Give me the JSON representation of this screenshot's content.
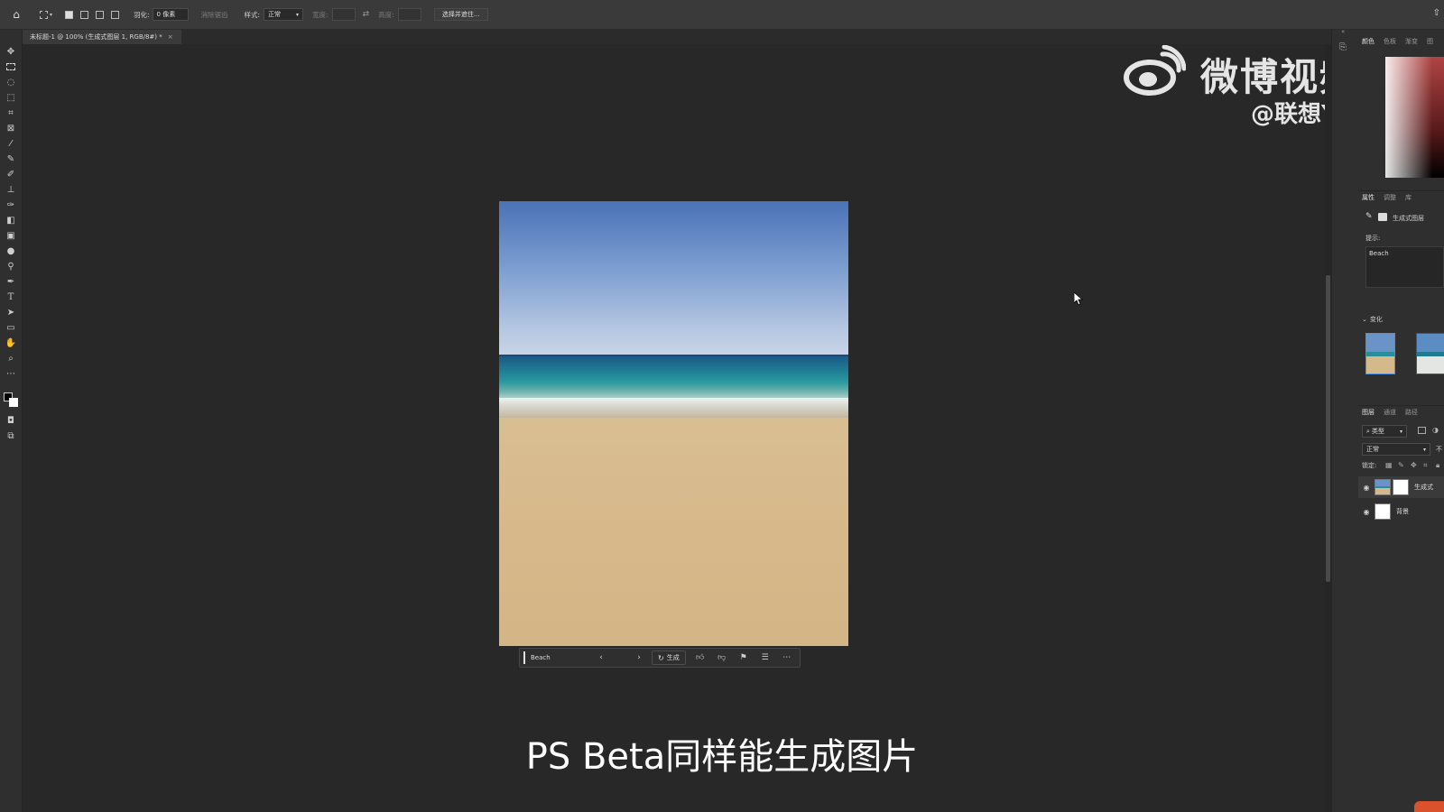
{
  "options_bar": {
    "feather_label": "羽化:",
    "feather_value": "0 像素",
    "antialias_label": "消除锯齿",
    "style_label": "样式:",
    "style_value": "正常",
    "width_label": "宽度:",
    "height_label": "高度:",
    "select_mask_button": "选择并遮住..."
  },
  "document_tab": {
    "title": "未标题-1 @ 100% (生成式图层 1, RGB/8#) *",
    "close": "×"
  },
  "contextual_taskbar": {
    "prompt_value": "Beach",
    "generate_label": "生成",
    "icons": [
      "chevron-left-icon",
      "chevron-right-icon",
      "refresh-icon",
      "thumbs-up-icon",
      "thumbs-down-icon",
      "flag-icon",
      "settings-sliders-icon",
      "more-icon"
    ]
  },
  "subtitle": "PS Beta同样能生成图片",
  "watermark": {
    "title": "微博视频号",
    "handle": "@联想YOGA"
  },
  "color_panel": {
    "tabs": [
      "颜色",
      "色板",
      "渐变",
      "图"
    ]
  },
  "properties_panel": {
    "tabs": [
      "属性",
      "调整",
      "库"
    ],
    "layer_type": "生成式图层",
    "prompt_label": "提示:",
    "prompt_value": "Beach",
    "variations_label": "变化"
  },
  "layers_panel": {
    "tabs": [
      "图层",
      "通道",
      "路径"
    ],
    "filter_kind": "类型",
    "blend_mode": "正常",
    "opacity_abbr": "不",
    "lock_label": "锁定:",
    "layers": [
      {
        "name": "生成式",
        "type": "generative"
      },
      {
        "name": "背景",
        "type": "background"
      }
    ]
  },
  "colors": {
    "ui_dark": "#282828",
    "panel": "#2f2f2f",
    "accent": "#4d8fe0",
    "sky": "#4b72b7",
    "sand": "#d7b98c"
  }
}
